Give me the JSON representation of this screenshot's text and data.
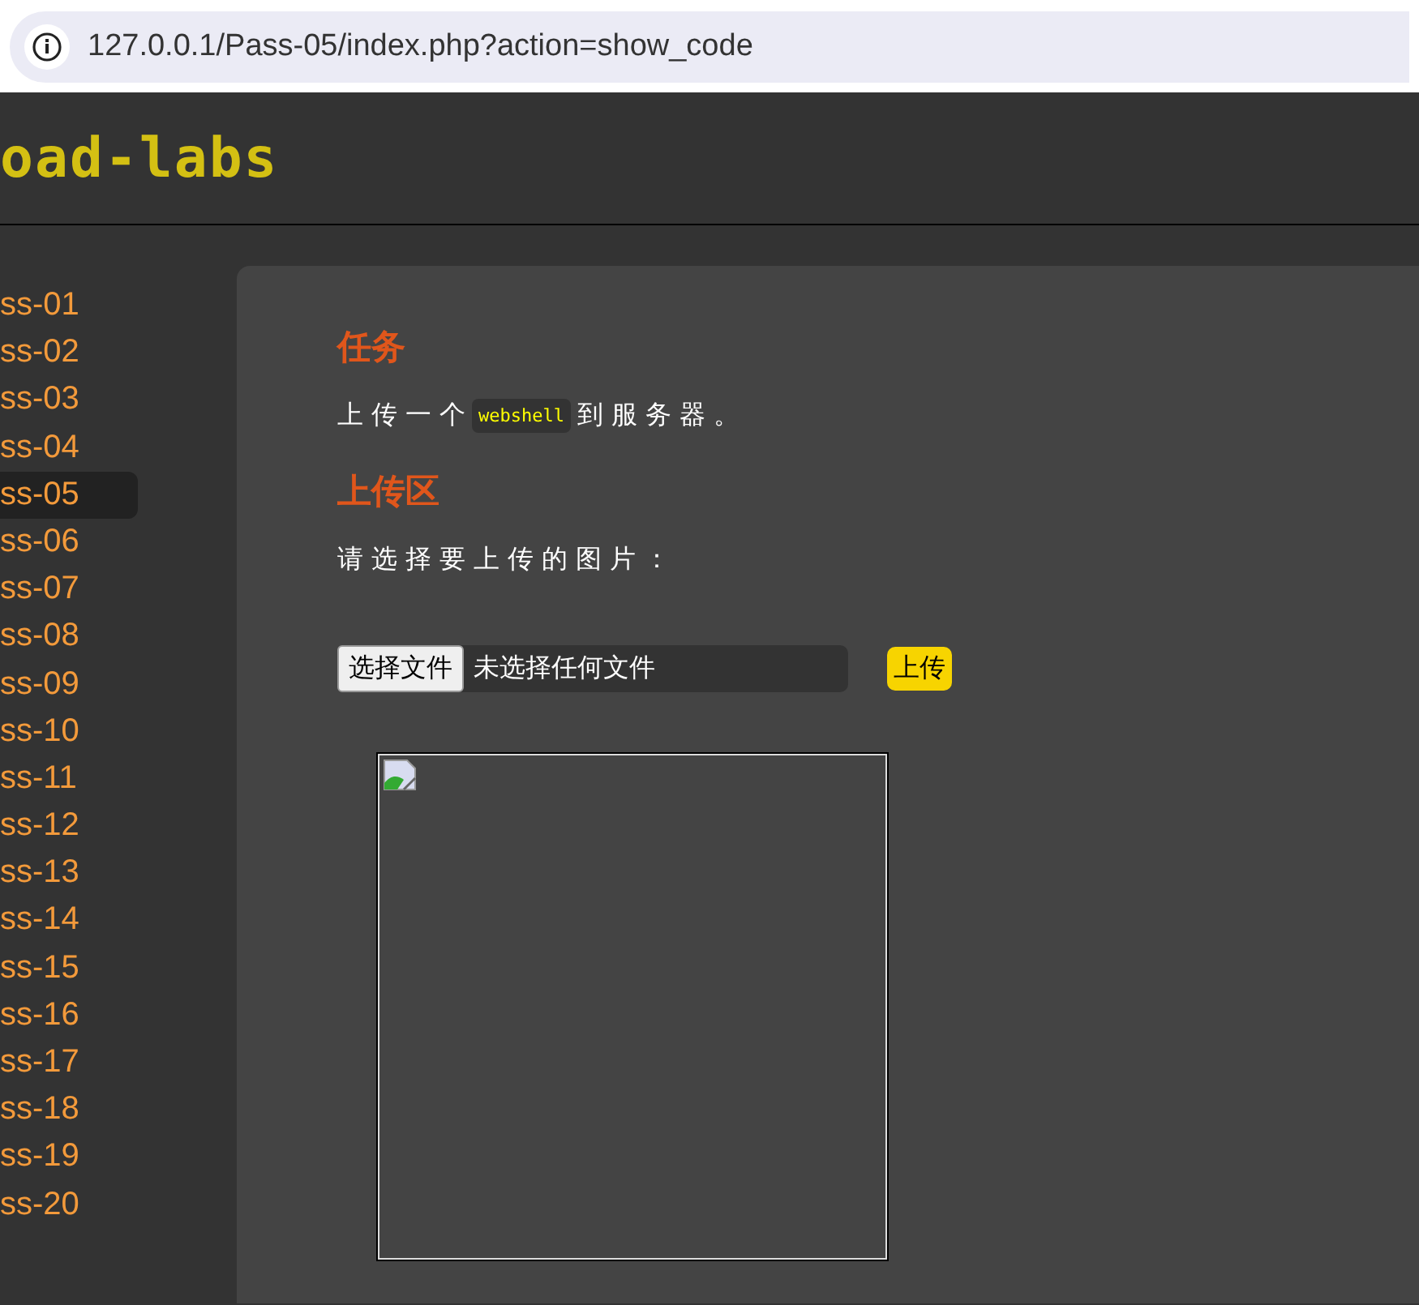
{
  "address_bar": {
    "url": "127.0.0.1/Pass-05/index.php?action=show_code"
  },
  "logo": "oad-labs",
  "sidebar": {
    "items": [
      {
        "label": "ss-01",
        "selected": false
      },
      {
        "label": "ss-02",
        "selected": false
      },
      {
        "label": "ss-03",
        "selected": false
      },
      {
        "label": "ss-04",
        "selected": false
      },
      {
        "label": "ss-05",
        "selected": true
      },
      {
        "label": "ss-06",
        "selected": false
      },
      {
        "label": "ss-07",
        "selected": false
      },
      {
        "label": "ss-08",
        "selected": false
      },
      {
        "label": "ss-09",
        "selected": false
      },
      {
        "label": "ss-10",
        "selected": false
      },
      {
        "label": "ss-11",
        "selected": false
      },
      {
        "label": "ss-12",
        "selected": false
      },
      {
        "label": "ss-13",
        "selected": false
      },
      {
        "label": "ss-14",
        "selected": false
      },
      {
        "label": "ss-15",
        "selected": false
      },
      {
        "label": "ss-16",
        "selected": false
      },
      {
        "label": "ss-17",
        "selected": false
      },
      {
        "label": "ss-18",
        "selected": false
      },
      {
        "label": "ss-19",
        "selected": false
      },
      {
        "label": "ss-20",
        "selected": false
      }
    ]
  },
  "task": {
    "heading": "任务",
    "before": "上传一个",
    "code": "webshell",
    "after": "到服务器。"
  },
  "upload": {
    "heading": "上传区",
    "prompt": "请选择要上传的图片：",
    "choose_button": "选择文件",
    "file_status": "未选择任何文件",
    "submit_button": "上传"
  }
}
